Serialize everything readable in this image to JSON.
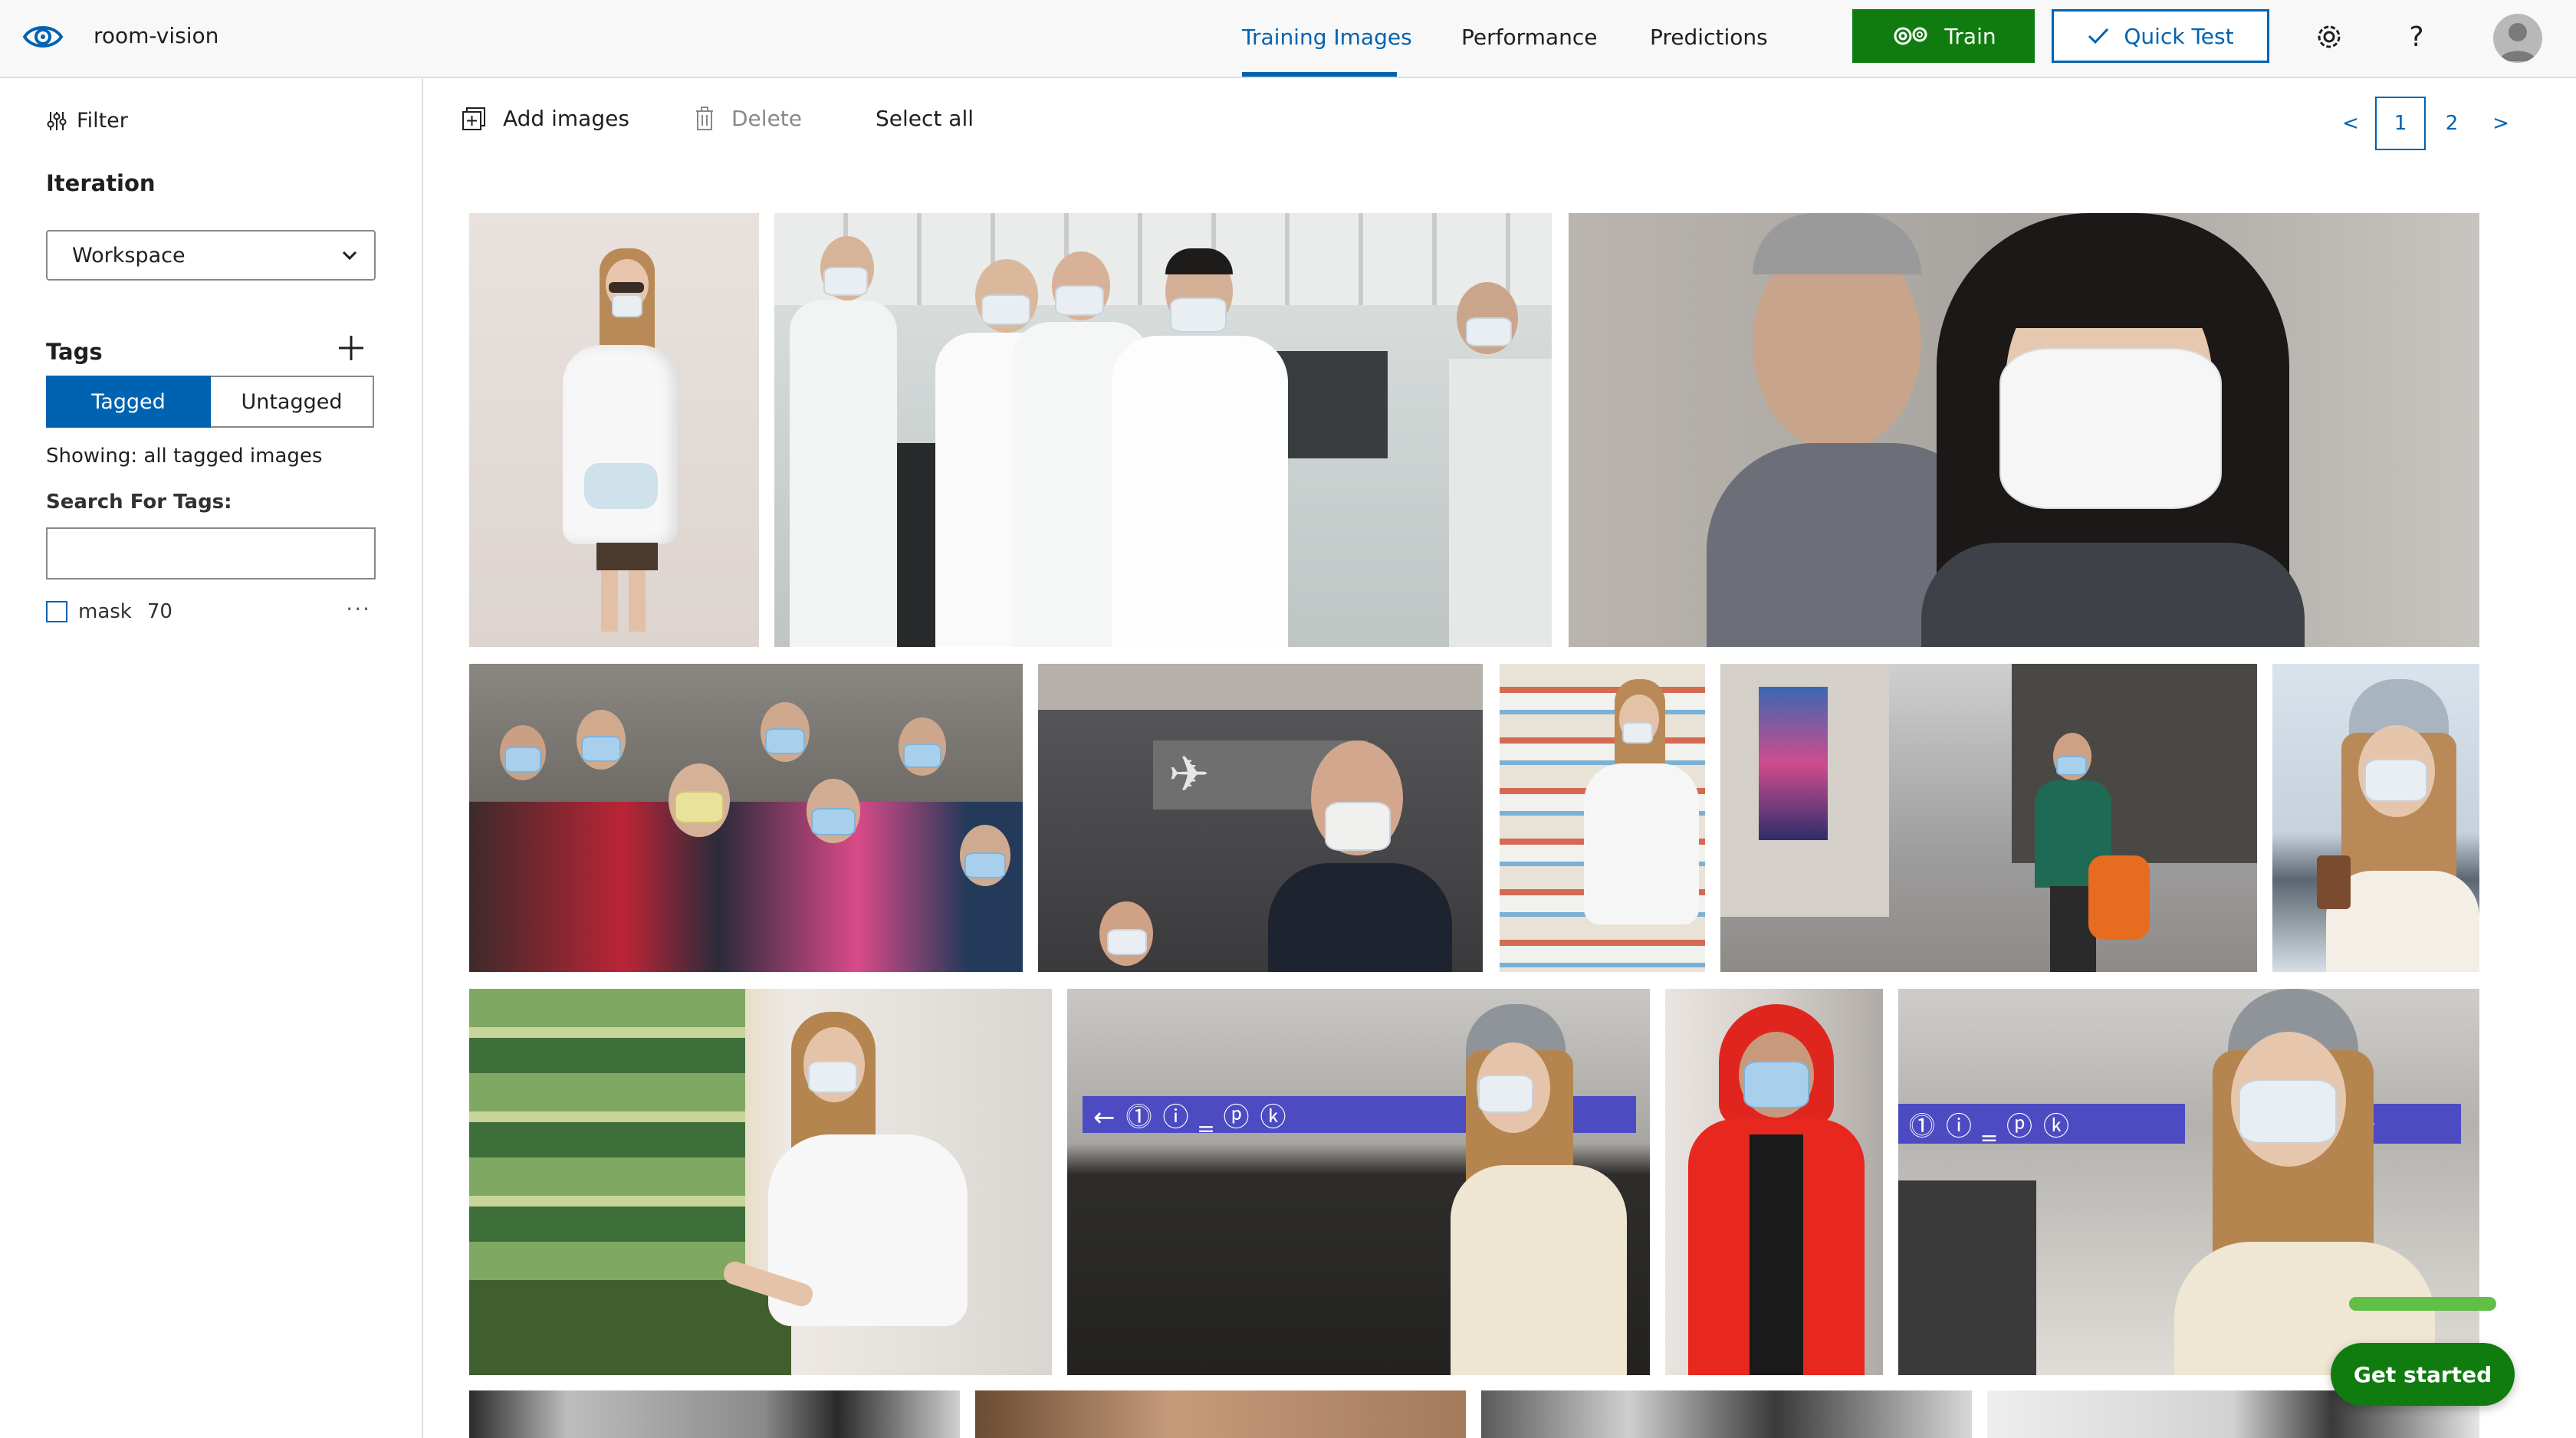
{
  "app": {
    "project_name": "room-vision",
    "brand_color": "#0063b1",
    "train_color": "#107c10"
  },
  "nav": {
    "tabs": [
      {
        "label": "Training Images",
        "active": true
      },
      {
        "label": "Performance",
        "active": false
      },
      {
        "label": "Predictions",
        "active": false
      }
    ],
    "train_label": "Train",
    "quick_test_label": "Quick Test"
  },
  "sidebar": {
    "filter_label": "Filter",
    "iteration_title": "Iteration",
    "iteration_selected": "Workspace",
    "tags_title": "Tags",
    "toggle": {
      "tagged": "Tagged",
      "untagged": "Untagged",
      "selected": "Tagged"
    },
    "showing_text": "Showing: all tagged images",
    "search_label": "Search For Tags:",
    "search_value": "",
    "tags": [
      {
        "name": "mask",
        "count": "70",
        "checked": false
      }
    ]
  },
  "toolbar": {
    "add_images": "Add images",
    "delete": "Delete",
    "select_all": "Select all"
  },
  "pager": {
    "prev": "<",
    "pages": [
      "1",
      "2"
    ],
    "current": "1",
    "next": ">"
  },
  "gallery": {
    "images": [
      {
        "row": 1,
        "subject": "woman-carrying-mask-street"
      },
      {
        "row": 1,
        "subject": "lab-workers-masks"
      },
      {
        "row": 1,
        "subject": "woman-mask-closeup"
      },
      {
        "row": 2,
        "subject": "crowd-masks"
      },
      {
        "row": 2,
        "subject": "man-respirator-arrivals"
      },
      {
        "row": 2,
        "subject": "woman-supermarket-aisle"
      },
      {
        "row": 2,
        "subject": "woman-mask-city-street"
      },
      {
        "row": 2,
        "subject": "woman-beanie-coffee"
      },
      {
        "row": 3,
        "subject": "woman-vegetables-produce"
      },
      {
        "row": 3,
        "subject": "woman-beanie-subway"
      },
      {
        "row": 3,
        "subject": "man-red-hoodie-mask"
      },
      {
        "row": 3,
        "subject": "woman-beanie-subway-closeup"
      },
      {
        "row": 4,
        "subject": "partial-image"
      },
      {
        "row": 4,
        "subject": "partial-image"
      },
      {
        "row": 4,
        "subject": "partial-image"
      },
      {
        "row": 4,
        "subject": "partial-image"
      }
    ]
  },
  "help": {
    "get_started": "Get started",
    "progress": 1.0
  }
}
